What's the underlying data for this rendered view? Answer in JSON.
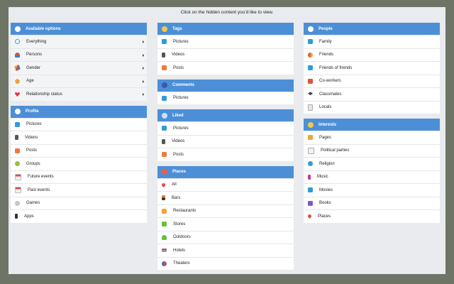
{
  "headline": "Click on the hidden content you'd like to view.",
  "available": {
    "title": "Available options",
    "items": [
      {
        "label": "Everything"
      },
      {
        "label": "Persons"
      },
      {
        "label": "Gender"
      },
      {
        "label": "Age"
      },
      {
        "label": "Relationship status"
      }
    ]
  },
  "profile": {
    "title": "Profile",
    "items": [
      {
        "label": "Pictures"
      },
      {
        "label": "Videos"
      },
      {
        "label": "Posts"
      },
      {
        "label": "Groups"
      },
      {
        "label": "Future events"
      },
      {
        "label": "Past events"
      },
      {
        "label": "Games"
      },
      {
        "label": "Apps"
      }
    ]
  },
  "tags": {
    "title": "Tags",
    "items": [
      {
        "label": "Pictures"
      },
      {
        "label": "Videos"
      },
      {
        "label": "Posts"
      }
    ]
  },
  "comments": {
    "title": "Comments",
    "items": [
      {
        "label": "Pictures"
      }
    ]
  },
  "liked": {
    "title": "Liked",
    "items": [
      {
        "label": "Pictures"
      },
      {
        "label": "Videos"
      },
      {
        "label": "Posts"
      }
    ]
  },
  "places": {
    "title": "Places",
    "items": [
      {
        "label": "All"
      },
      {
        "label": "Bars"
      },
      {
        "label": "Restaurants"
      },
      {
        "label": "Stores"
      },
      {
        "label": "Outdoors"
      },
      {
        "label": "Hotels"
      },
      {
        "label": "Theaters"
      }
    ]
  },
  "people": {
    "title": "People",
    "items": [
      {
        "label": "Family"
      },
      {
        "label": "Friends"
      },
      {
        "label": "Friends of friends"
      },
      {
        "label": "Co-workers"
      },
      {
        "label": "Classmates"
      },
      {
        "label": "Locals"
      }
    ]
  },
  "interests": {
    "title": "Interests",
    "items": [
      {
        "label": "Pages"
      },
      {
        "label": "Political parties"
      },
      {
        "label": "Religion"
      },
      {
        "label": "Music"
      },
      {
        "label": "Movies"
      },
      {
        "label": "Books"
      },
      {
        "label": "Places"
      }
    ]
  },
  "colors": {
    "header_blue": "#4d8fd6",
    "background": "#6e7566",
    "stage": "#e9ebee"
  }
}
